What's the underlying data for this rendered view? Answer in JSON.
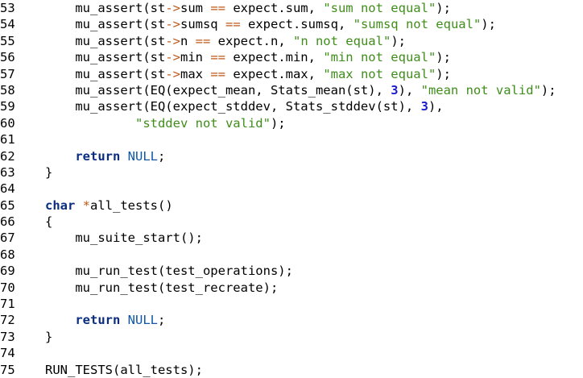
{
  "colors": {
    "background": "#ffffff",
    "text": "#000000",
    "keyword": "#0b2d80",
    "string": "#3f8d1a",
    "number": "#1b1bcf",
    "operator": "#c05a1a",
    "null_constant": "#0f57a8"
  },
  "lines": [
    {
      "num": "53",
      "tokens": [
        {
          "t": "    mu_assert(st",
          "c": ""
        },
        {
          "t": "->",
          "c": "op"
        },
        {
          "t": "sum ",
          "c": ""
        },
        {
          "t": "==",
          "c": "op"
        },
        {
          "t": " expect.sum, ",
          "c": ""
        },
        {
          "t": "\"sum not equal\"",
          "c": "str"
        },
        {
          "t": ");",
          "c": ""
        }
      ]
    },
    {
      "num": "54",
      "tokens": [
        {
          "t": "    mu_assert(st",
          "c": ""
        },
        {
          "t": "->",
          "c": "op"
        },
        {
          "t": "sumsq ",
          "c": ""
        },
        {
          "t": "==",
          "c": "op"
        },
        {
          "t": " expect.sumsq, ",
          "c": ""
        },
        {
          "t": "\"sumsq not equal\"",
          "c": "str"
        },
        {
          "t": ");",
          "c": ""
        }
      ]
    },
    {
      "num": "55",
      "tokens": [
        {
          "t": "    mu_assert(st",
          "c": ""
        },
        {
          "t": "->",
          "c": "op"
        },
        {
          "t": "n ",
          "c": ""
        },
        {
          "t": "==",
          "c": "op"
        },
        {
          "t": " expect.n, ",
          "c": ""
        },
        {
          "t": "\"n not equal\"",
          "c": "str"
        },
        {
          "t": ");",
          "c": ""
        }
      ]
    },
    {
      "num": "56",
      "tokens": [
        {
          "t": "    mu_assert(st",
          "c": ""
        },
        {
          "t": "->",
          "c": "op"
        },
        {
          "t": "min ",
          "c": ""
        },
        {
          "t": "==",
          "c": "op"
        },
        {
          "t": " expect.min, ",
          "c": ""
        },
        {
          "t": "\"min not equal\"",
          "c": "str"
        },
        {
          "t": ");",
          "c": ""
        }
      ]
    },
    {
      "num": "57",
      "tokens": [
        {
          "t": "    mu_assert(st",
          "c": ""
        },
        {
          "t": "->",
          "c": "op"
        },
        {
          "t": "max ",
          "c": ""
        },
        {
          "t": "==",
          "c": "op"
        },
        {
          "t": " expect.max, ",
          "c": ""
        },
        {
          "t": "\"max not equal\"",
          "c": "str"
        },
        {
          "t": ");",
          "c": ""
        }
      ]
    },
    {
      "num": "58",
      "tokens": [
        {
          "t": "    mu_assert(EQ(expect_mean, Stats_mean(st), ",
          "c": ""
        },
        {
          "t": "3",
          "c": "num"
        },
        {
          "t": "), ",
          "c": ""
        },
        {
          "t": "\"mean not valid\"",
          "c": "str"
        },
        {
          "t": ");",
          "c": ""
        }
      ]
    },
    {
      "num": "59",
      "tokens": [
        {
          "t": "    mu_assert(EQ(expect_stddev, Stats_stddev(st), ",
          "c": ""
        },
        {
          "t": "3",
          "c": "num"
        },
        {
          "t": "),",
          "c": ""
        }
      ]
    },
    {
      "num": "60",
      "tokens": [
        {
          "t": "            ",
          "c": ""
        },
        {
          "t": "\"stddev not valid\"",
          "c": "str"
        },
        {
          "t": ");",
          "c": ""
        }
      ]
    },
    {
      "num": "61",
      "tokens": []
    },
    {
      "num": "62",
      "tokens": [
        {
          "t": "    ",
          "c": ""
        },
        {
          "t": "return",
          "c": "kw"
        },
        {
          "t": " ",
          "c": ""
        },
        {
          "t": "NULL",
          "c": "nullc"
        },
        {
          "t": ";",
          "c": ""
        }
      ]
    },
    {
      "num": "63",
      "tokens": [
        {
          "t": "}",
          "c": ""
        }
      ]
    },
    {
      "num": "64",
      "tokens": []
    },
    {
      "num": "65",
      "tokens": [
        {
          "t": "char",
          "c": "ty"
        },
        {
          "t": " ",
          "c": ""
        },
        {
          "t": "*",
          "c": "op"
        },
        {
          "t": "all_tests()",
          "c": ""
        }
      ]
    },
    {
      "num": "66",
      "tokens": [
        {
          "t": "{",
          "c": ""
        }
      ]
    },
    {
      "num": "67",
      "tokens": [
        {
          "t": "    mu_suite_start();",
          "c": ""
        }
      ]
    },
    {
      "num": "68",
      "tokens": []
    },
    {
      "num": "69",
      "tokens": [
        {
          "t": "    mu_run_test(test_operations);",
          "c": ""
        }
      ]
    },
    {
      "num": "70",
      "tokens": [
        {
          "t": "    mu_run_test(test_recreate);",
          "c": ""
        }
      ]
    },
    {
      "num": "71",
      "tokens": []
    },
    {
      "num": "72",
      "tokens": [
        {
          "t": "    ",
          "c": ""
        },
        {
          "t": "return",
          "c": "kw"
        },
        {
          "t": " ",
          "c": ""
        },
        {
          "t": "NULL",
          "c": "nullc"
        },
        {
          "t": ";",
          "c": ""
        }
      ]
    },
    {
      "num": "73",
      "tokens": [
        {
          "t": "}",
          "c": ""
        }
      ]
    },
    {
      "num": "74",
      "tokens": []
    },
    {
      "num": "75",
      "tokens": [
        {
          "t": "RUN_TESTS(all_tests);",
          "c": ""
        }
      ]
    }
  ]
}
